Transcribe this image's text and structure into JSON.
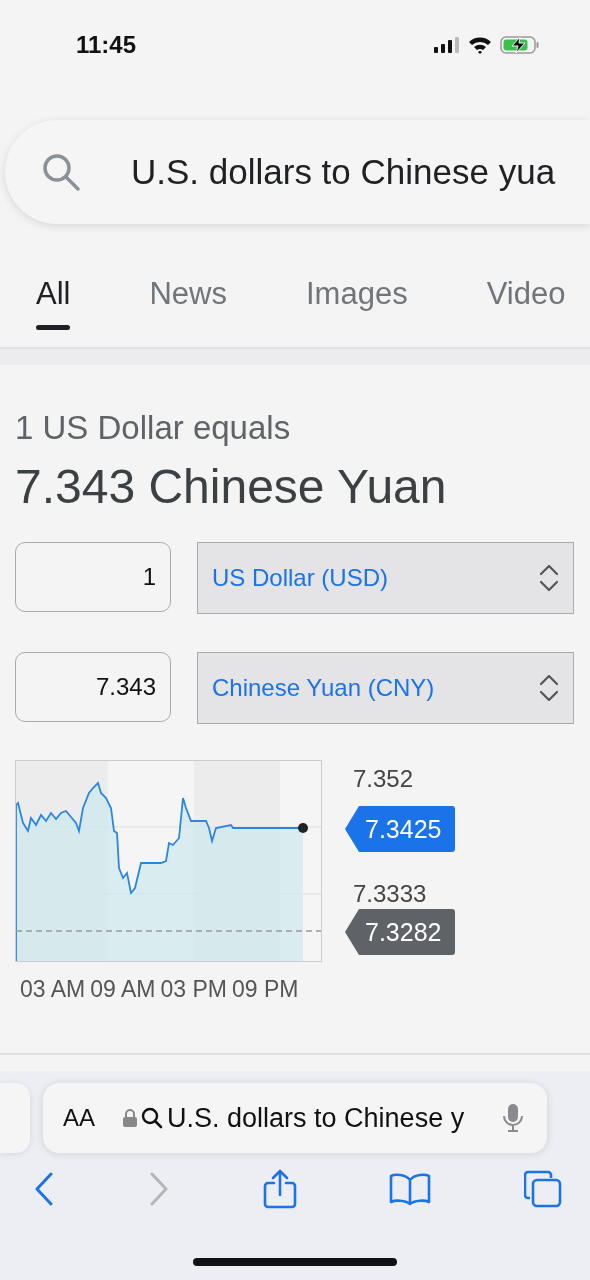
{
  "status_bar": {
    "time": "11:45"
  },
  "search": {
    "value": "U.S. dollars to Chinese yua"
  },
  "tabs": [
    {
      "label": "All",
      "selected": true
    },
    {
      "label": "News",
      "selected": false
    },
    {
      "label": "Images",
      "selected": false
    },
    {
      "label": "Video",
      "selected": false
    }
  ],
  "converter": {
    "heading": "1 US Dollar equals",
    "result": "7.343 Chinese Yuan",
    "rows": [
      {
        "amount": "1",
        "currency": "US Dollar (USD)"
      },
      {
        "amount": "7.343",
        "currency": "Chinese Yuan (CNY)"
      }
    ]
  },
  "chart": {
    "high_label": "7.352",
    "current_tag": "7.3425",
    "low_label": "7.3333",
    "previous_tag": "7.3282",
    "time_labels": [
      "03 AM",
      "09 AM",
      "03 PM",
      "09 PM"
    ]
  },
  "address_bar": {
    "text_size_label": "AA",
    "query": "U.S. dollars to Chinese y"
  },
  "toolbar": [
    {
      "kind": "back",
      "disabled": false
    },
    {
      "kind": "forward",
      "disabled": true
    },
    {
      "kind": "share",
      "disabled": false
    },
    {
      "kind": "bookmarks",
      "disabled": false
    },
    {
      "kind": "tabs",
      "disabled": false
    }
  ]
}
